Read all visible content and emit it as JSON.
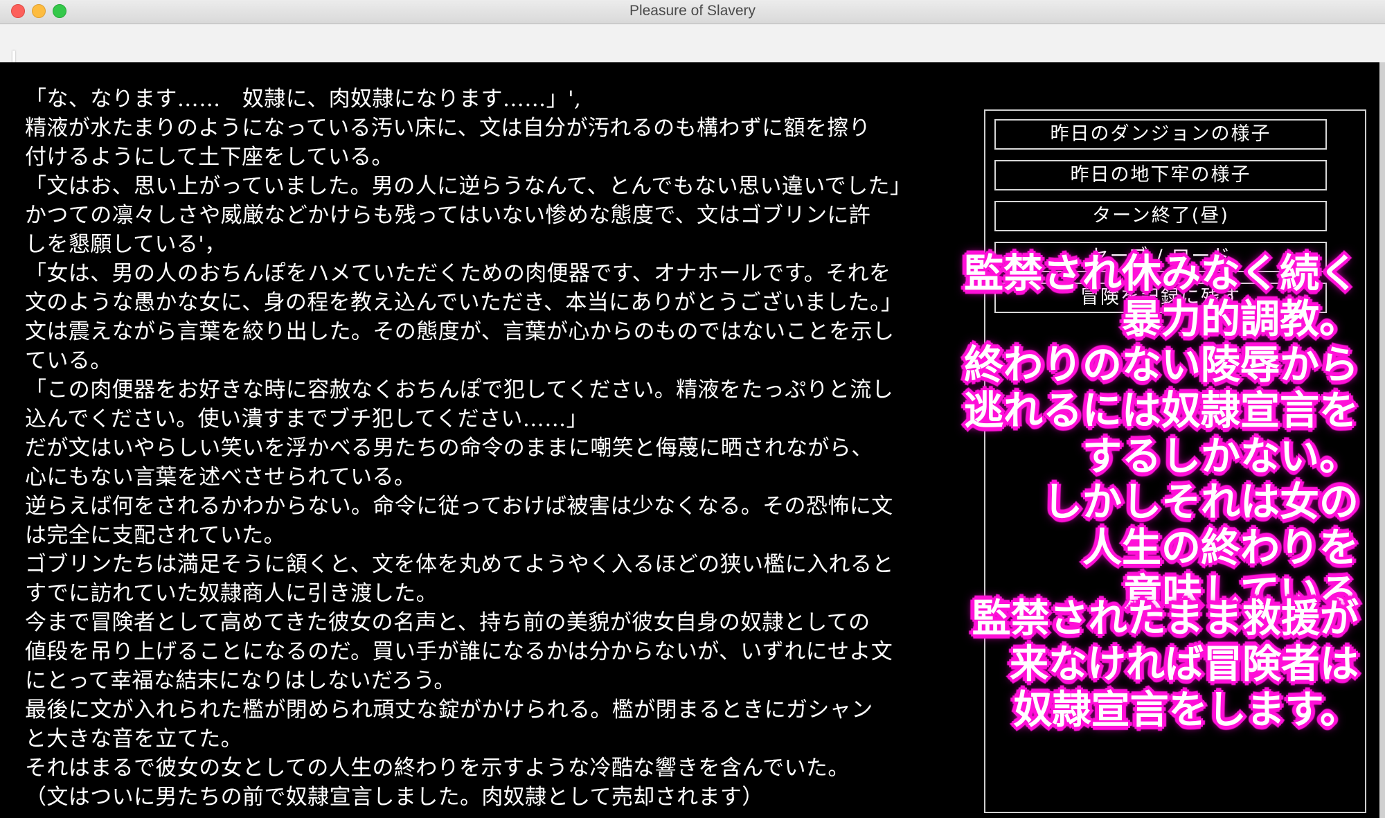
{
  "window": {
    "title": "Pleasure of Slavery"
  },
  "story_lines": [
    "「な、なります……　奴隷に、肉奴隷になります……」',",
    "精液が水たまりのようになっている汚い床に、文は自分が汚れるのも構わずに額を擦り",
    "付けるようにして土下座をしている。",
    "「文はお、思い上がっていました。男の人に逆らうなんて、とんでもない思い違いでした」",
    "かつての凛々しさや威厳などかけらも残ってはいない惨めな態度で、文はゴブリンに許",
    "しを懇願している'，",
    "「女は、男の人のおちんぽをハメていただくための肉便器です、オナホールです。それを",
    "文のような愚かな女に、身の程を教え込んでいただき、本当にありがとうございました。」",
    "文は震えながら言葉を絞り出した。その態度が、言葉が心からのものではないことを示し",
    "ている。",
    "「この肉便器をお好きな時に容赦なくおちんぽで犯してください。精液をたっぷりと流し",
    "込んでください。使い潰すまでブチ犯してください……」",
    "だが文はいやらしい笑いを浮かべる男たちの命令のままに嘲笑と侮蔑に晒されながら、",
    "心にもない言葉を述べさせられている。",
    "逆らえば何をされるかわからない。命令に従っておけば被害は少なくなる。その恐怖に文",
    "は完全に支配されていた。",
    "ゴブリンたちは満足そうに頷くと、文を体を丸めてようやく入るほどの狭い檻に入れると",
    "すでに訪れていた奴隷商人に引き渡した。",
    "今まで冒険者として高めてきた彼女の名声と、持ち前の美貌が彼女自身の奴隷としての",
    "値段を吊り上げることになるのだ。買い手が誰になるかは分からないが、いずれにせよ文",
    "にとって幸福な結末になりはしないだろう。",
    "最後に文が入れられた檻が閉められ頑丈な錠がかけられる。檻が閉まるときにガシャン",
    "と大きな音を立てた。",
    "それはまるで彼女の女としての人生の終わりを示すような冷酷な響きを含んでいた。",
    "（文はついに男たちの前で奴隷宣言しました。肉奴隷として売却されます）"
  ],
  "menu": {
    "dungeon_yesterday": "昨日のダンジョンの様子",
    "dungeon_cell_yesterday": "昨日の地下牢の様子",
    "end_turn": "ターン終了(昼)",
    "save_load": "セーブ / ロード",
    "record_adventure": "冒険を記録に残す"
  },
  "promo_1": [
    "監禁され休みなく続く",
    "暴力的調教。",
    "終わりのない陵辱から",
    "逃れるには奴隷宣言を",
    "するしかない。",
    "しかしそれは女の",
    "人生の終わりを",
    "意味している"
  ],
  "promo_2": [
    "監禁されたまま救援が",
    "来なければ冒険者は",
    "奴隷宣言をします。"
  ],
  "colors": {
    "outline_accent": "#ff10d8",
    "screen_bg": "#000000",
    "text": "#ffffff"
  }
}
